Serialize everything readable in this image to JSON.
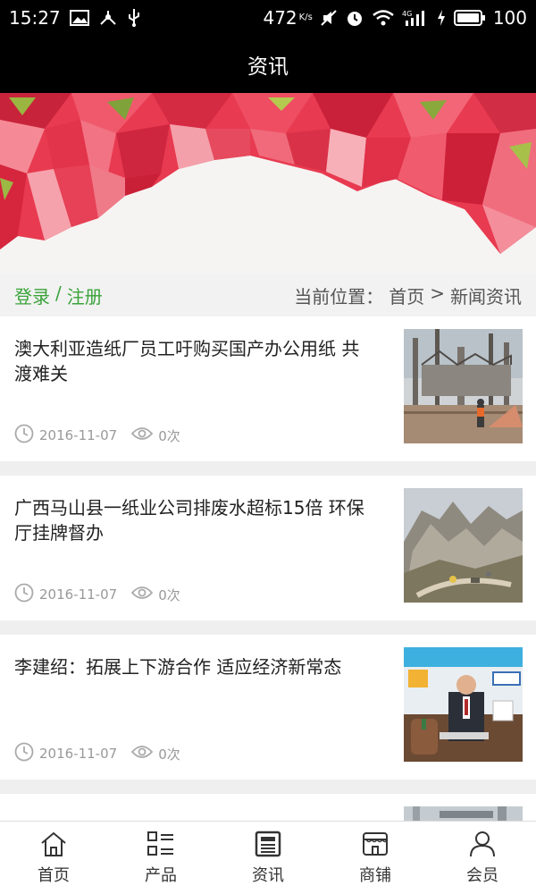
{
  "status_bar": {
    "time": "15:27",
    "net_speed": "472",
    "net_unit": "K/s",
    "network_label": "4G",
    "battery": "100"
  },
  "title_bar": {
    "title": "资讯"
  },
  "location_bar": {
    "login": "登录",
    "separator": "/",
    "register": "注册",
    "current_label": "当前位置：",
    "home": "首页",
    "arrow": ">",
    "section": "新闻资讯"
  },
  "news": [
    {
      "title": "澳大利亚造纸厂员工吁购买国产办公用纸 共渡难关",
      "date": "2016-11-07",
      "views": "0次",
      "thumb": "factory"
    },
    {
      "title": "广西马山县一纸业公司排废水超标15倍 环保厅挂牌督办",
      "date": "2016-11-07",
      "views": "0次",
      "thumb": "quarry"
    },
    {
      "title": "李建绍：拓展上下游合作 适应经济新常态",
      "date": "2016-11-07",
      "views": "0次",
      "thumb": "speaker"
    }
  ],
  "tab_bar": {
    "items": [
      {
        "label": "首页",
        "icon": "home-icon"
      },
      {
        "label": "产品",
        "icon": "grid-list-icon"
      },
      {
        "label": "资讯",
        "icon": "news-icon",
        "active": true
      },
      {
        "label": "商铺",
        "icon": "store-icon"
      },
      {
        "label": "会员",
        "icon": "user-icon"
      }
    ]
  },
  "colors": {
    "accent": "#3aa33a",
    "header_bg": "#000000",
    "banner_red": "#e8334a"
  }
}
